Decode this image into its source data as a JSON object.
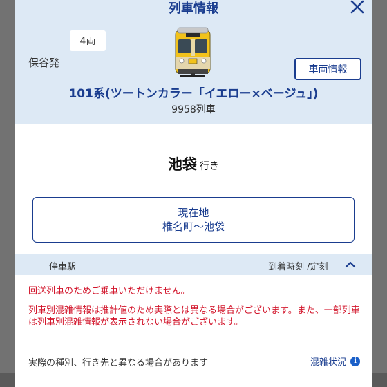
{
  "modal": {
    "title": "列車情報",
    "cars": "4両",
    "origin": "保谷発",
    "vehicle_info_button": "車両情報",
    "train_name": "101系(ツートンカラー「イエロー×ベージュ」)",
    "train_number": "9958列車",
    "destination": {
      "name": "池袋",
      "suffix": "行き"
    },
    "current_location": {
      "label": "現在地",
      "value": "椎名町〜池袋"
    },
    "table_header": {
      "station": "停車駅",
      "time": "到着時刻 /定刻"
    },
    "notices": {
      "out_of_service": "回送列車のためご乗車いただけません。",
      "congestion": "列車別混雑情報は推計値のため実際とは異なる場合がございます。また、一部列車は列車別混雑情報が表示されない場合がございます。"
    },
    "footer": {
      "note": "実際の種別、行き先と異なる場合があります",
      "congestion_link": "混雑状況"
    }
  },
  "icons": {
    "close": "close-icon",
    "train": "train-icon",
    "chevron": "chevron-up-icon",
    "info": "info-icon"
  },
  "colors": {
    "accent": "#1a3d8f",
    "header_bg": "#dde9f5",
    "warning": "#d2142a",
    "train_yellow": "#f2c21b"
  }
}
